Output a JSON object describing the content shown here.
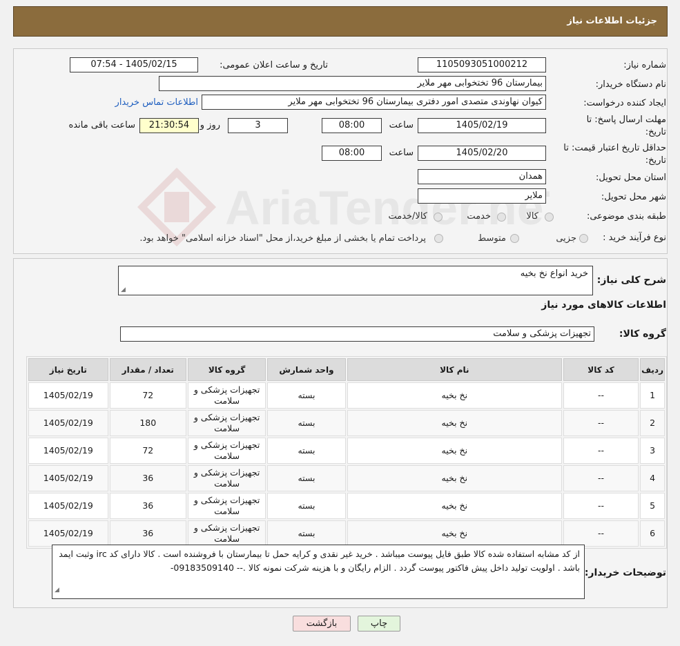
{
  "header": {
    "title": "جزئیات اطلاعات نیاز"
  },
  "form": {
    "need_number_label": "شماره نیاز:",
    "need_number": "1105093051000212",
    "announce_label": "تاریخ و ساعت اعلان عمومی:",
    "announce_value": "1405/02/15 - 07:54",
    "buyer_org_label": "نام دستگاه خریدار:",
    "buyer_org": "بیمارستان 96 تختخوابی مهر ملایر",
    "creator_label": "ایجاد کننده درخواست:",
    "creator": "کیوان نهاوندی متصدی امور دفتری بیمارستان 96 تختخوابی مهر ملایر",
    "contact_link": "اطلاعات تماس خریدار",
    "deadline_label_1": "مهلت ارسال پاسخ: تا",
    "deadline_label_2": "تاریخ:",
    "deadline_date": "1405/02/19",
    "time_label": "ساعت",
    "deadline_time": "08:00",
    "days": "3",
    "days_label": "روز و",
    "remaining_time": "21:30:54",
    "remaining_label": "ساعت باقی مانده",
    "validity_label_1": "حداقل تاریخ اعتبار قیمت: تا",
    "validity_label_2": "تاریخ:",
    "validity_date": "1405/02/20",
    "validity_time": "08:00",
    "province_label": "استان محل تحویل:",
    "province": "همدان",
    "city_label": "شهر محل تحویل:",
    "city": "ملایر",
    "category_label": "طبقه بندی موضوعی:",
    "category_options": [
      "کالا",
      "خدمت",
      "کالا/خدمت"
    ],
    "process_label": "نوع فرآیند خرید :",
    "process_options": [
      "جزیی",
      "متوسط"
    ],
    "process_note": "پرداخت تمام یا بخشی از مبلغ خرید،از محل \"اسناد خزانه اسلامی\" خواهد بود."
  },
  "summary": {
    "label": "شرح کلی نیاز:",
    "value": "خرید انواع نخ بخیه",
    "goods_info_title": "اطلاعات کالاهای مورد نیاز",
    "goods_group_label": "گروه کالا:",
    "goods_group": "تجهیزات پزشکی و سلامت"
  },
  "table": {
    "headers": [
      "ردیف",
      "کد کالا",
      "نام کالا",
      "واحد شمارش",
      "گروه کالا",
      "تعداد / مقدار",
      "تاریخ نیاز"
    ],
    "rows": [
      [
        "1",
        "--",
        "نخ بخیه",
        "بسته",
        "تجهیزات پزشکی و سلامت",
        "72",
        "1405/02/19"
      ],
      [
        "2",
        "--",
        "نخ بخیه",
        "بسته",
        "تجهیزات پزشکی و سلامت",
        "180",
        "1405/02/19"
      ],
      [
        "3",
        "--",
        "نخ بخیه",
        "بسته",
        "تجهیزات پزشکی و سلامت",
        "72",
        "1405/02/19"
      ],
      [
        "4",
        "--",
        "نخ بخیه",
        "بسته",
        "تجهیزات پزشکی و سلامت",
        "36",
        "1405/02/19"
      ],
      [
        "5",
        "--",
        "نخ بخیه",
        "بسته",
        "تجهیزات پزشکی و سلامت",
        "36",
        "1405/02/19"
      ],
      [
        "6",
        "--",
        "نخ بخیه",
        "بسته",
        "تجهیزات پزشکی و سلامت",
        "36",
        "1405/02/19"
      ]
    ]
  },
  "notes": {
    "label": "توضیحات خریدار:",
    "value": "از کد مشابه استفاده شده کالا طبق فایل پیوست  میباشد . خرید غیر نقدی  و کرایه حمل تا بیمارستان با فروشنده است . کالا دارای کد irc  وثبت ایمد باشد .  اولویت تولید داخل پیش فاکتور پیوست گردد . الزام رایگان و با هزینه شرکت نمونه کالا .-- 09183509140-"
  },
  "buttons": {
    "back": "بازگشت",
    "print": "چاپ"
  },
  "watermark": {
    "text": "AriaTender.neT"
  },
  "colors": {
    "header": "#8b6c3d",
    "link": "#1f5fbf",
    "back_button": "#f9dede",
    "print_button": "#e3f5dc"
  }
}
